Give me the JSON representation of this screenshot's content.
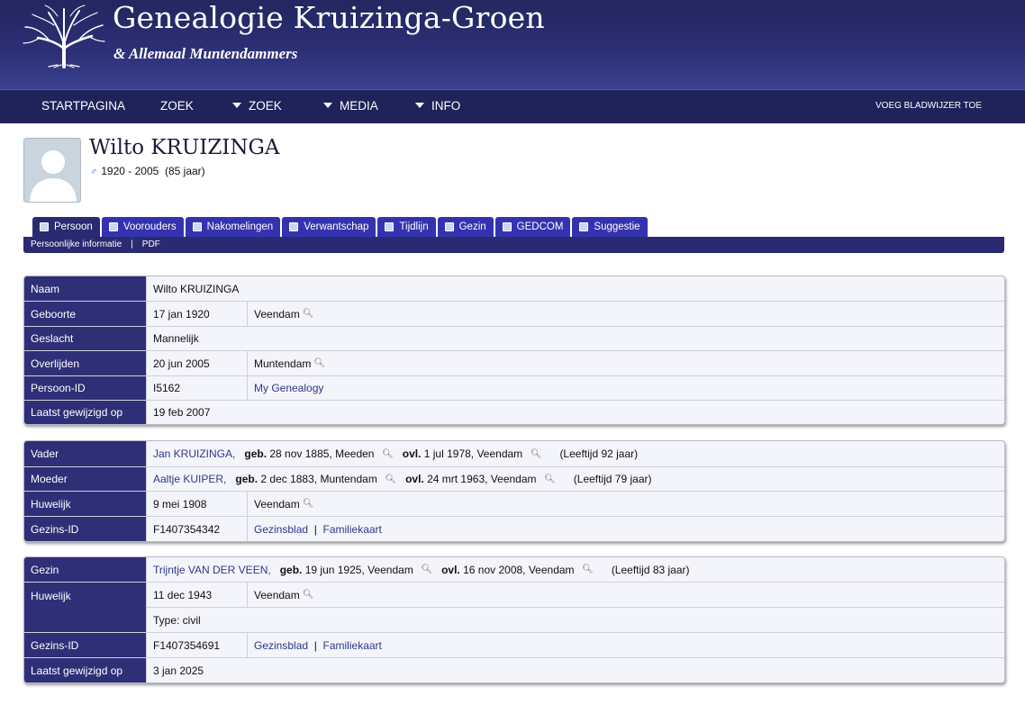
{
  "site": {
    "title": "Genealogie Kruizinga-Groen",
    "subtitle": "& Allemaal Muntendammers"
  },
  "nav": {
    "startpagina": "STARTPAGINA",
    "zoek1": "ZOEK",
    "zoek2": "ZOEK",
    "media": "MEDIA",
    "info": "INFO",
    "bookmark": "VOEG BLADWIJZER TOE"
  },
  "person": {
    "name": "Wilto KRUIZINGA",
    "gender_symbol": "♂",
    "dates": "1920 - 2005  (85 jaar)"
  },
  "tabs": [
    "Persoon",
    "Voorouders",
    "Nakomelingen",
    "Verwantschap",
    "Tijdlijn",
    "Gezin",
    "GEDCOM",
    "Suggestie"
  ],
  "subnav": {
    "info": "Persoonlijke informatie",
    "sep": "|",
    "pdf": "PDF"
  },
  "personal": {
    "naam_label": "Naam",
    "naam": "Wilto KRUIZINGA",
    "geboorte_label": "Geboorte",
    "geboorte_datum": "17 jan 1920",
    "geboorte_plaats": "Veendam",
    "geslacht_label": "Geslacht",
    "geslacht": "Mannelijk",
    "overlijden_label": "Overlijden",
    "overlijden_datum": "20 jun 2005",
    "overlijden_plaats": "Muntendam",
    "id_label": "Persoon-ID",
    "id": "I5162",
    "tree": "My Genealogy",
    "gewijzigd_label": "Laatst gewijzigd op",
    "gewijzigd": "19 feb 2007"
  },
  "parents": {
    "vader_label": "Vader",
    "vader_naam": "Jan KRUIZINGA,",
    "vader_geb_label": "geb.",
    "vader_geb": "28 nov 1885, Meeden",
    "vader_ovl_label": "ovl.",
    "vader_ovl": "1 jul 1978, Veendam",
    "vader_leeftijd": "(Leeftijd 92 jaar)",
    "moeder_label": "Moeder",
    "moeder_naam": "Aaltje KUIPER,",
    "moeder_geb_label": "geb.",
    "moeder_geb": "2 dec 1883, Muntendam",
    "moeder_ovl_label": "ovl.",
    "moeder_ovl": "24 mrt 1963, Veendam",
    "moeder_leeftijd": "(Leeftijd 79 jaar)",
    "huwelijk_label": "Huwelijk",
    "huwelijk_datum": "9 mei 1908",
    "huwelijk_plaats": "Veendam",
    "gezins_label": "Gezins-ID",
    "gezins_id": "F1407354342",
    "gezinsblad": "Gezinsblad",
    "sep": "|",
    "familiekaart": "Familiekaart"
  },
  "family": {
    "gezin_label": "Gezin",
    "partner_naam": "Trijntje VAN DER VEEN,",
    "partner_geb_label": "geb.",
    "partner_geb": "19 jun 1925, Veendam",
    "partner_ovl_label": "ovl.",
    "partner_ovl": "16 nov 2008, Veendam",
    "partner_leeftijd": "(Leeftijd 83 jaar)",
    "huwelijk_label": "Huwelijk",
    "huwelijk_datum": "11 dec 1943",
    "huwelijk_plaats": "Veendam",
    "huwelijk_type": "Type: civil",
    "gezins_label": "Gezins-ID",
    "gezins_id": "F1407354691",
    "gezinsblad": "Gezinsblad",
    "sep": "|",
    "familiekaart": "Familiekaart",
    "gewijzigd_label": "Laatst gewijzigd op",
    "gewijzigd": "3 jan 2025"
  },
  "colors": {
    "header": "#2c2f75",
    "nav": "#20235a",
    "label_bg": "#2f2f78",
    "tab": "#3532b0",
    "link": "#2c3a8a"
  },
  "icons": {
    "search": "magnifier-icon",
    "logo": "tree-logo-icon",
    "avatar": "person-silhouette-icon"
  }
}
